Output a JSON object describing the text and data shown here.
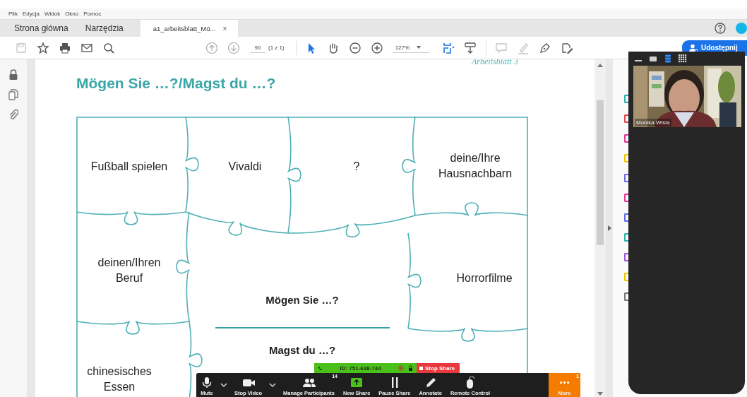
{
  "menu": [
    "Plik",
    "Edycja",
    "Widok",
    "Okno",
    "Pomoc"
  ],
  "tabs": [
    {
      "label": "Strona główna",
      "selected": false
    },
    {
      "label": "Narzędzia",
      "selected": false
    },
    {
      "label": "a1_arbeitsblatt_Mö...",
      "selected": true,
      "close": "×"
    }
  ],
  "toolbar": {
    "tools_left": [
      {
        "kind": "save",
        "disabled": true
      },
      {
        "kind": "star",
        "disabled": false
      },
      {
        "kind": "print",
        "disabled": false
      },
      {
        "kind": "mail",
        "disabled": false
      },
      {
        "kind": "find",
        "disabled": false
      }
    ],
    "page": "90",
    "page_count": "(1 z 1)",
    "tools_mid": [
      {
        "kind": "select",
        "selected": true
      },
      {
        "kind": "hand",
        "selected": false
      },
      {
        "kind": "zoomout",
        "selected": false
      },
      {
        "kind": "zoomin",
        "selected": false
      }
    ],
    "zoom": "127%",
    "tools_right": [
      {
        "kind": "fit",
        "disabled": false
      },
      {
        "kind": "scroll",
        "disabled": false
      },
      {
        "kind": "comment",
        "disabled": true
      },
      {
        "kind": "highlight",
        "disabled": true
      },
      {
        "kind": "sign",
        "disabled": false
      },
      {
        "kind": "edit",
        "disabled": false
      }
    ],
    "share_button": "Udostępnij"
  },
  "side_tools": [
    {
      "color": "#2bb3b0"
    },
    {
      "color": "#e5484d"
    },
    {
      "color": "#e0399a"
    },
    {
      "color": "#f2c500"
    },
    {
      "color": "#6b6bf0"
    },
    {
      "color": "#e0399a"
    },
    {
      "color": "#5b6ef5"
    },
    {
      "color": "#2bb3b0"
    },
    {
      "color": "#9b55e0"
    },
    {
      "color": "#f2c500"
    },
    {
      "color": "#777777"
    }
  ],
  "document": {
    "header": "Arbeitsblatt 3",
    "title": "Mögen Sie …?/Magst du …?",
    "pieces": [
      {
        "text": "Fußball spielen",
        "bold": false
      },
      {
        "text": "Vivaldi",
        "bold": false
      },
      {
        "text": "?",
        "bold": false
      },
      {
        "text": "deine/Ihre Hausnachbarn",
        "bold": false
      },
      {
        "text": "deinen/Ihren Beruf",
        "bold": false
      },
      {
        "text": "Horrorfilme",
        "bold": false
      },
      {
        "text": "Mögen Sie …?",
        "bold": true
      },
      {
        "text": "Magst du …?",
        "bold": true
      },
      {
        "text": "chinesisches Essen",
        "bold": false
      }
    ]
  },
  "meeting": {
    "id": "ID: 751-638-744",
    "stop_share": "Stop Share",
    "controls": [
      {
        "label": "Mute",
        "kind": "mic",
        "menu": true
      },
      {
        "label": "Stop Video",
        "kind": "camera",
        "menu": true
      },
      {
        "label": "Manage Participants",
        "kind": "participants",
        "badge": "14"
      },
      {
        "label": "New Share",
        "kind": "share"
      },
      {
        "label": "Pause Share",
        "kind": "pause"
      },
      {
        "label": "Annotate",
        "kind": "pencil"
      },
      {
        "label": "Remote Control",
        "kind": "mouse"
      },
      {
        "label": "More",
        "kind": "more",
        "badge": "1",
        "highlight": true
      }
    ],
    "view_modes": [
      {
        "kind": "minimize",
        "selected": false
      },
      {
        "kind": "single",
        "selected": false
      },
      {
        "kind": "strip",
        "selected": true
      },
      {
        "kind": "grid",
        "selected": false
      }
    ],
    "video": {
      "name": "Monika Wisla"
    }
  }
}
